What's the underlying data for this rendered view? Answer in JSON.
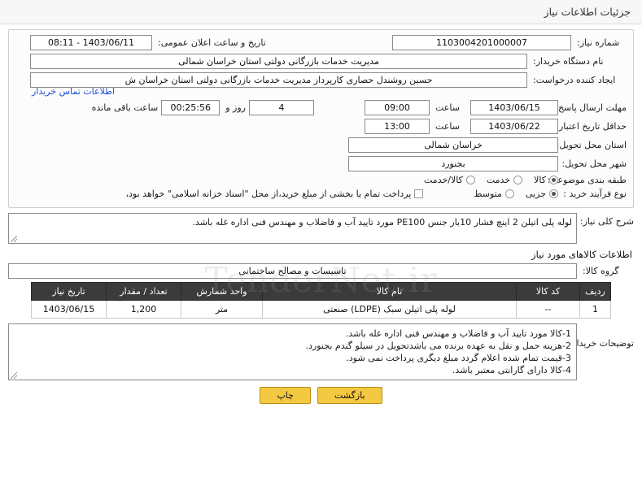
{
  "header": {
    "title": "جزئیات اطلاعات نیاز"
  },
  "watermark": "TenderNet.ir",
  "form": {
    "need_number_label": "شماره نیاز:",
    "need_number_value": "1103004201000007",
    "announce_date_label": "تاریخ و ساعت اعلان عمومی:",
    "announce_date_value": "1403/06/11 - 08:11",
    "buyer_org_label": "نام دستگاه خریدار:",
    "buyer_org_value": "مدیریت خدمات بازرگانی دولتی استان خراسان شمالی",
    "creator_label": "ایجاد کننده درخواست:",
    "creator_value": "حسین روشندل حصاری کارپرداز مدیریت خدمات بازرگانی دولتی استان خراسان ش",
    "creator_link": "اطلاعات تماس خریدار",
    "deadline_label": "مهلت ارسال پاسخ: تا تاریخ:",
    "deadline_date": "1403/06/15",
    "deadline_hour_label": "ساعت",
    "deadline_hour": "09:00",
    "remaining_days": "4",
    "remaining_days_label": "روز و",
    "remaining_time": "00:25:56",
    "remaining_suffix": "ساعت باقی مانده",
    "price_validity_label": "حداقل تاریخ اعتبار قیمت: تا تاریخ:",
    "price_validity_date": "1403/06/22",
    "price_validity_hour_label": "ساعت",
    "price_validity_hour": "13:00",
    "province_label": "استان محل تحویل:",
    "province_value": "خراسان شمالی",
    "city_label": "شهر محل تحویل:",
    "city_value": "بجنورد",
    "category_label": "طبقه بندی موضوعی:",
    "category_options": [
      "کالا",
      "خدمت",
      "کالا/خدمت"
    ],
    "category_selected": 0,
    "process_label": "نوع فرآیند خرید :",
    "process_options": [
      "جزیی",
      "متوسط"
    ],
    "process_selected": 0,
    "payment_checkbox_text": "پرداخت تمام یا بخشی از مبلغ خرید،از محل \"اسناد خزانه اسلامی\" خواهد بود،",
    "payment_checked": false
  },
  "description": {
    "label": "شرح کلی نیاز:",
    "text": "لوله پلی اتیلن 2 اینچ فشار 10بار جنس PE100 مورد تایید آب و فاضلاب و مهندس فنی اداره غله باشد."
  },
  "goods_section": {
    "title": "اطلاعات کالاهای مورد نیاز",
    "group_label": "گروه کالا:",
    "group_value": "تاسیسات و مصالح ساختمانی",
    "columns": [
      "ردیف",
      "کد کالا",
      "نام کالا",
      "واحد شمارش",
      "تعداد / مقدار",
      "تاریخ نیاز"
    ],
    "rows": [
      [
        "1",
        "--",
        "لوله پلی اتیلن سبک (LDPE) صنعتی",
        "متر",
        "1,200",
        "1403/06/15"
      ]
    ]
  },
  "notes": {
    "label": "توضیحات خریدار:",
    "lines": [
      "1-کالا مورد تایید آب و فاضلاب و مهندس فنی اداره غله باشد.",
      "2-هزینه حمل و نقل به عهده برنده می باشدتحویل در سیلو گندم بجنورد.",
      "3-قیمت تمام شده اعلام گردد مبلغ دیگری پرداخت نمی شود.",
      "4-کالا دارای گارانتی معتبر باشد."
    ]
  },
  "footer": {
    "print_label": "چاپ",
    "back_label": "بازگشت"
  }
}
